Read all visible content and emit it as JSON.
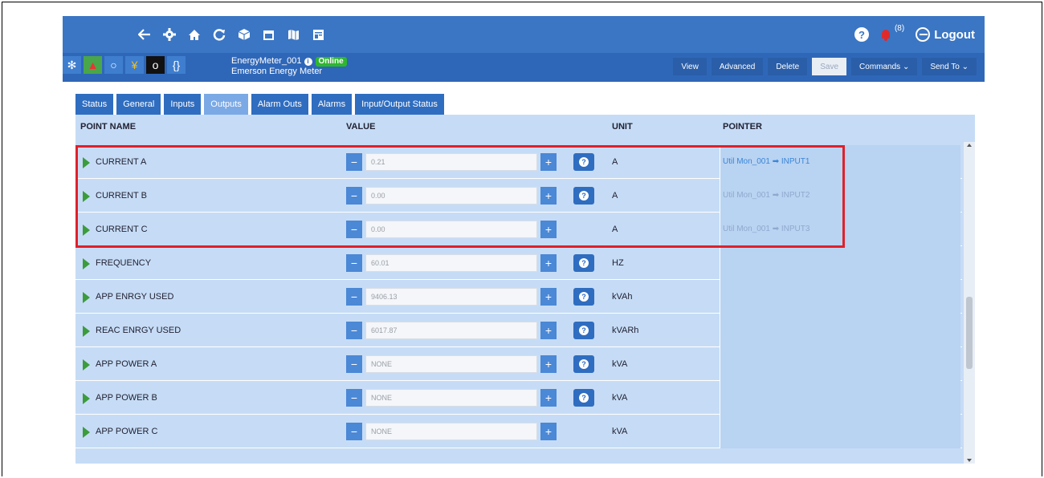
{
  "colors": {
    "topbar": "#3b76c4",
    "devbar": "#2f67b8",
    "row_bg": "#c6dcf6",
    "highlight": "#e0202a",
    "online": "#2fb62f"
  },
  "topbar": {
    "nav_icons": [
      "back-arrow-icon",
      "gear-icon",
      "home-icon",
      "refresh-icon",
      "cube-icon",
      "calendar-icon",
      "map-icon",
      "report-icon"
    ],
    "notif_count": "(8)",
    "logout_label": "Logout"
  },
  "device": {
    "name": "EnergyMeter_001",
    "status": "Online",
    "type": "Emerson Energy Meter",
    "actions": [
      "View",
      "Advanced",
      "Delete",
      "Save",
      "Commands ⌄",
      "Send To ⌄"
    ]
  },
  "tabs": [
    "Status",
    "General",
    "Inputs",
    "Outputs",
    "Alarm Outs",
    "Alarms",
    "Input/Output Status"
  ],
  "active_tab": "Outputs",
  "table": {
    "headers": {
      "point_name": "POINT NAME",
      "value": "VALUE",
      "unit": "UNIT",
      "pointer": "POINTER"
    },
    "rows": [
      {
        "name": "CURRENT A",
        "value": "0.21",
        "unit": "A",
        "pointer": "Util Mon_001 ➡ INPUT1",
        "help": true
      },
      {
        "name": "CURRENT B",
        "value": "0.00",
        "unit": "A",
        "pointer": "Util Mon_001 ➡ INPUT2",
        "help": true
      },
      {
        "name": "CURRENT C",
        "value": "0.00",
        "unit": "A",
        "pointer": "Util Mon_001 ➡ INPUT3",
        "help": false
      },
      {
        "name": "FREQUENCY",
        "value": "60.01",
        "unit": "HZ",
        "pointer": "",
        "help": true
      },
      {
        "name": "APP ENRGY USED",
        "value": "9406.13",
        "unit": "kVAh",
        "pointer": "",
        "help": true
      },
      {
        "name": "REAC ENRGY USED",
        "value": "6017.87",
        "unit": "kVARh",
        "pointer": "",
        "help": true
      },
      {
        "name": "APP POWER A",
        "value": "NONE",
        "unit": "kVA",
        "pointer": "",
        "help": true
      },
      {
        "name": "APP POWER B",
        "value": "NONE",
        "unit": "kVA",
        "pointer": "",
        "help": true
      },
      {
        "name": "APP POWER C",
        "value": "NONE",
        "unit": "kVA",
        "pointer": "",
        "help": false
      }
    ]
  }
}
